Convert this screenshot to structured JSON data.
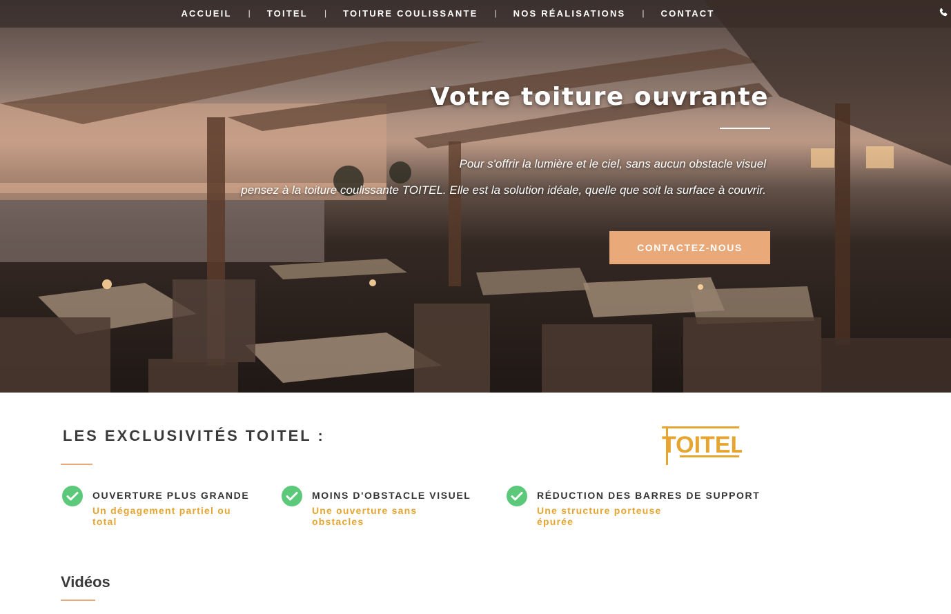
{
  "nav": {
    "items": [
      {
        "label": "ACCUEIL"
      },
      {
        "label": "TOITEL"
      },
      {
        "label": "TOITURE COULISSANTE"
      },
      {
        "label": "NOS RÉALISATIONS"
      },
      {
        "label": "CONTACT"
      }
    ],
    "separator": "|",
    "phone_icon": "phone-icon"
  },
  "hero": {
    "title": "Votre toiture ouvrante",
    "line1": "Pour s'offrir la lumière et le ciel, sans aucun obstacle visuel",
    "line2": "pensez à la toiture coulissante TOITEL. Elle est la solution idéale, quelle que soit la surface à couvrir.",
    "cta_label": "CONTACTEZ-NOUS"
  },
  "exclusivites": {
    "title": "LES EXCLUSIVITÉS TOITEL :",
    "logo_text": "TOITEL",
    "features": [
      {
        "title": "OUVERTURE PLUS GRANDE",
        "subtitle": "Un dégagement partiel ou total",
        "icon": "check-circle-icon"
      },
      {
        "title": "MOINS D'OBSTACLE VISUEL",
        "subtitle": "Une ouverture sans obstacles",
        "icon": "check-circle-icon"
      },
      {
        "title": "RÉDUCTION DES BARRES DE SUPPORT",
        "subtitle": "Une structure porteuse épurée",
        "icon": "check-circle-icon"
      }
    ]
  },
  "videos": {
    "title": "Vidéos"
  },
  "colors": {
    "accent": "#e9a978",
    "feature_sub": "#e5a530",
    "check": "#5cc97a",
    "logo": "#e5a530"
  }
}
